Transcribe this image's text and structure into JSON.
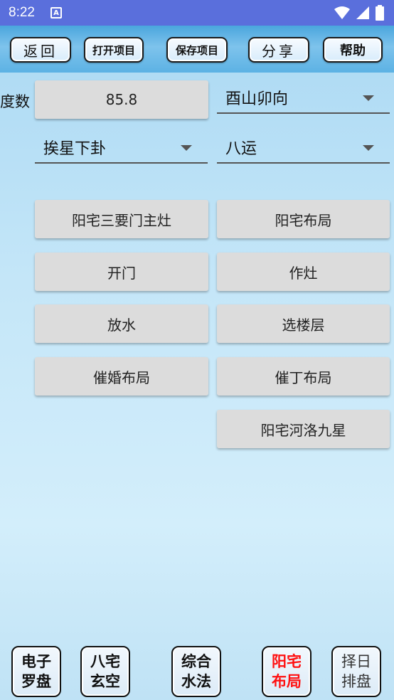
{
  "status": {
    "time": "8:22",
    "notification_glyph": "A"
  },
  "toolbar": {
    "back": "返回",
    "open_project": "打开项目",
    "save_project": "保存项目",
    "share": "分享",
    "help": "帮助"
  },
  "form": {
    "degree_label": "度数",
    "degree_value": "85.8",
    "direction_selected": "酉山卯向",
    "star_method_selected": "挨星下卦",
    "period_selected": "八运"
  },
  "menu": {
    "items": [
      "阳宅三要门主灶",
      "阳宅布局",
      "开门",
      "作灶",
      "放水",
      "选楼层",
      "催婚布局",
      "催丁布局",
      "阳宅河洛九星"
    ]
  },
  "bottom_nav": {
    "compass_l1": "电子",
    "compass_l2": "罗盘",
    "bazhai_l1": "八宅",
    "bazhai_l2": "玄空",
    "water_l1": "综合",
    "water_l2": "水法",
    "yangzhai_l1": "阳宅",
    "yangzhai_l2": "布局",
    "date_l1": "择日",
    "date_l2": "排盘"
  },
  "colors": {
    "status_bar": "#5a6fdc",
    "active_nav": "#ff1010",
    "button_gray": "#dcdcdc"
  }
}
